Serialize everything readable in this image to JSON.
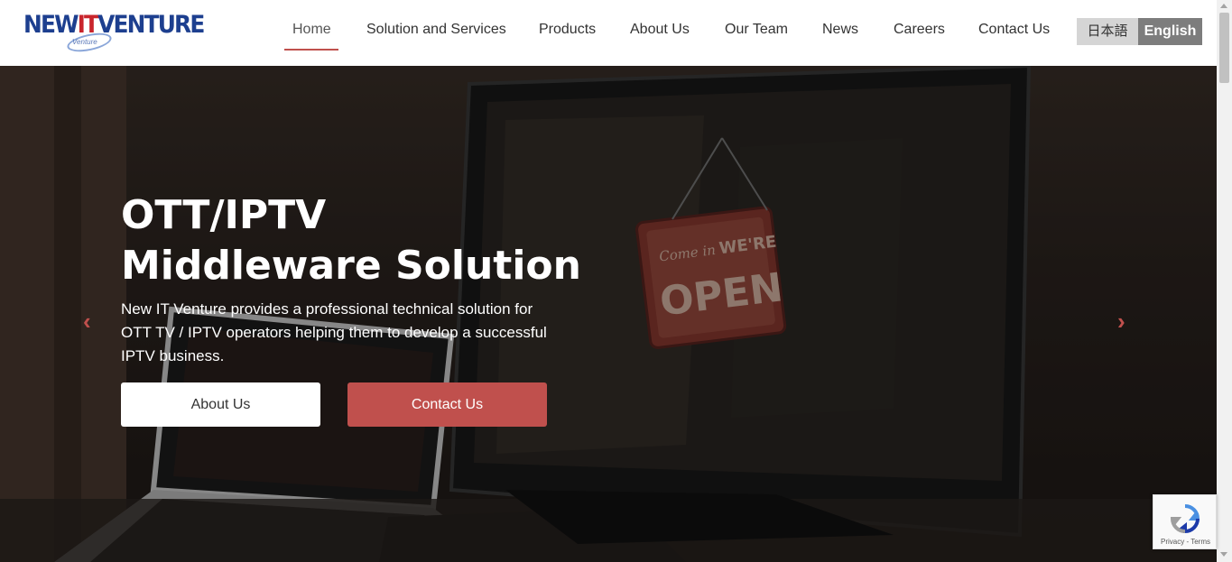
{
  "brand": {
    "logo_main": "NEW",
    "logo_it": "IT",
    "logo_rest": "VENTURE",
    "logo_sub": "Venture"
  },
  "nav": {
    "items": [
      {
        "label": "Home"
      },
      {
        "label": "Solution and Services"
      },
      {
        "label": "Products"
      },
      {
        "label": "About Us"
      },
      {
        "label": "Our Team"
      },
      {
        "label": "News"
      },
      {
        "label": "Careers"
      },
      {
        "label": "Contact Us"
      }
    ],
    "active": "Home"
  },
  "language": {
    "ja": "日本語",
    "en": "English",
    "selected": "English"
  },
  "hero": {
    "title": "OTT/IPTV Middleware Solution",
    "description": "New IT Venture provides a professional technical solution for OTT TV / IPTV operators helping them to develop a successful IPTV business.",
    "primary_button": "About Us",
    "secondary_button": "Contact Us",
    "prev_arrow": "‹",
    "next_arrow": "›"
  },
  "recaptcha": {
    "text": "Privacy - Terms"
  },
  "colors": {
    "accent": "#c0504d",
    "brand_blue": "#1d3f8f",
    "brand_red": "#c9252c"
  }
}
